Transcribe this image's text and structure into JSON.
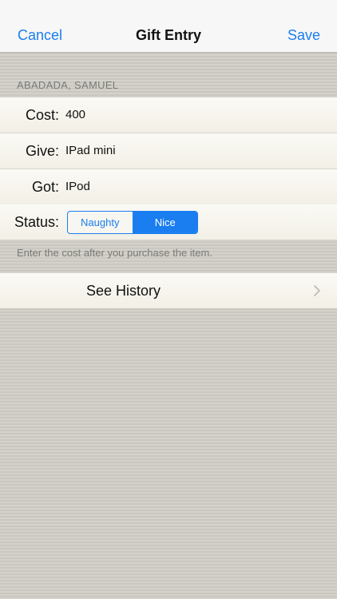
{
  "navbar": {
    "cancel_label": "Cancel",
    "title": "Gift Entry",
    "save_label": "Save"
  },
  "section": {
    "header": "ABADADA, SAMUEL"
  },
  "fields": {
    "cost": {
      "label": "Cost:",
      "value": "400"
    },
    "give": {
      "label": "Give:",
      "value": "IPad mini"
    },
    "got": {
      "label": "Got:",
      "value": "IPod"
    }
  },
  "status": {
    "label": "Status:",
    "options": [
      "Naughty",
      "Nice"
    ],
    "selected": "Nice"
  },
  "hint": "Enter the cost after you purchase the item.",
  "history": {
    "label": "See History",
    "icon": "chevron-right-icon"
  },
  "colors": {
    "accent": "#1a7ef0"
  }
}
